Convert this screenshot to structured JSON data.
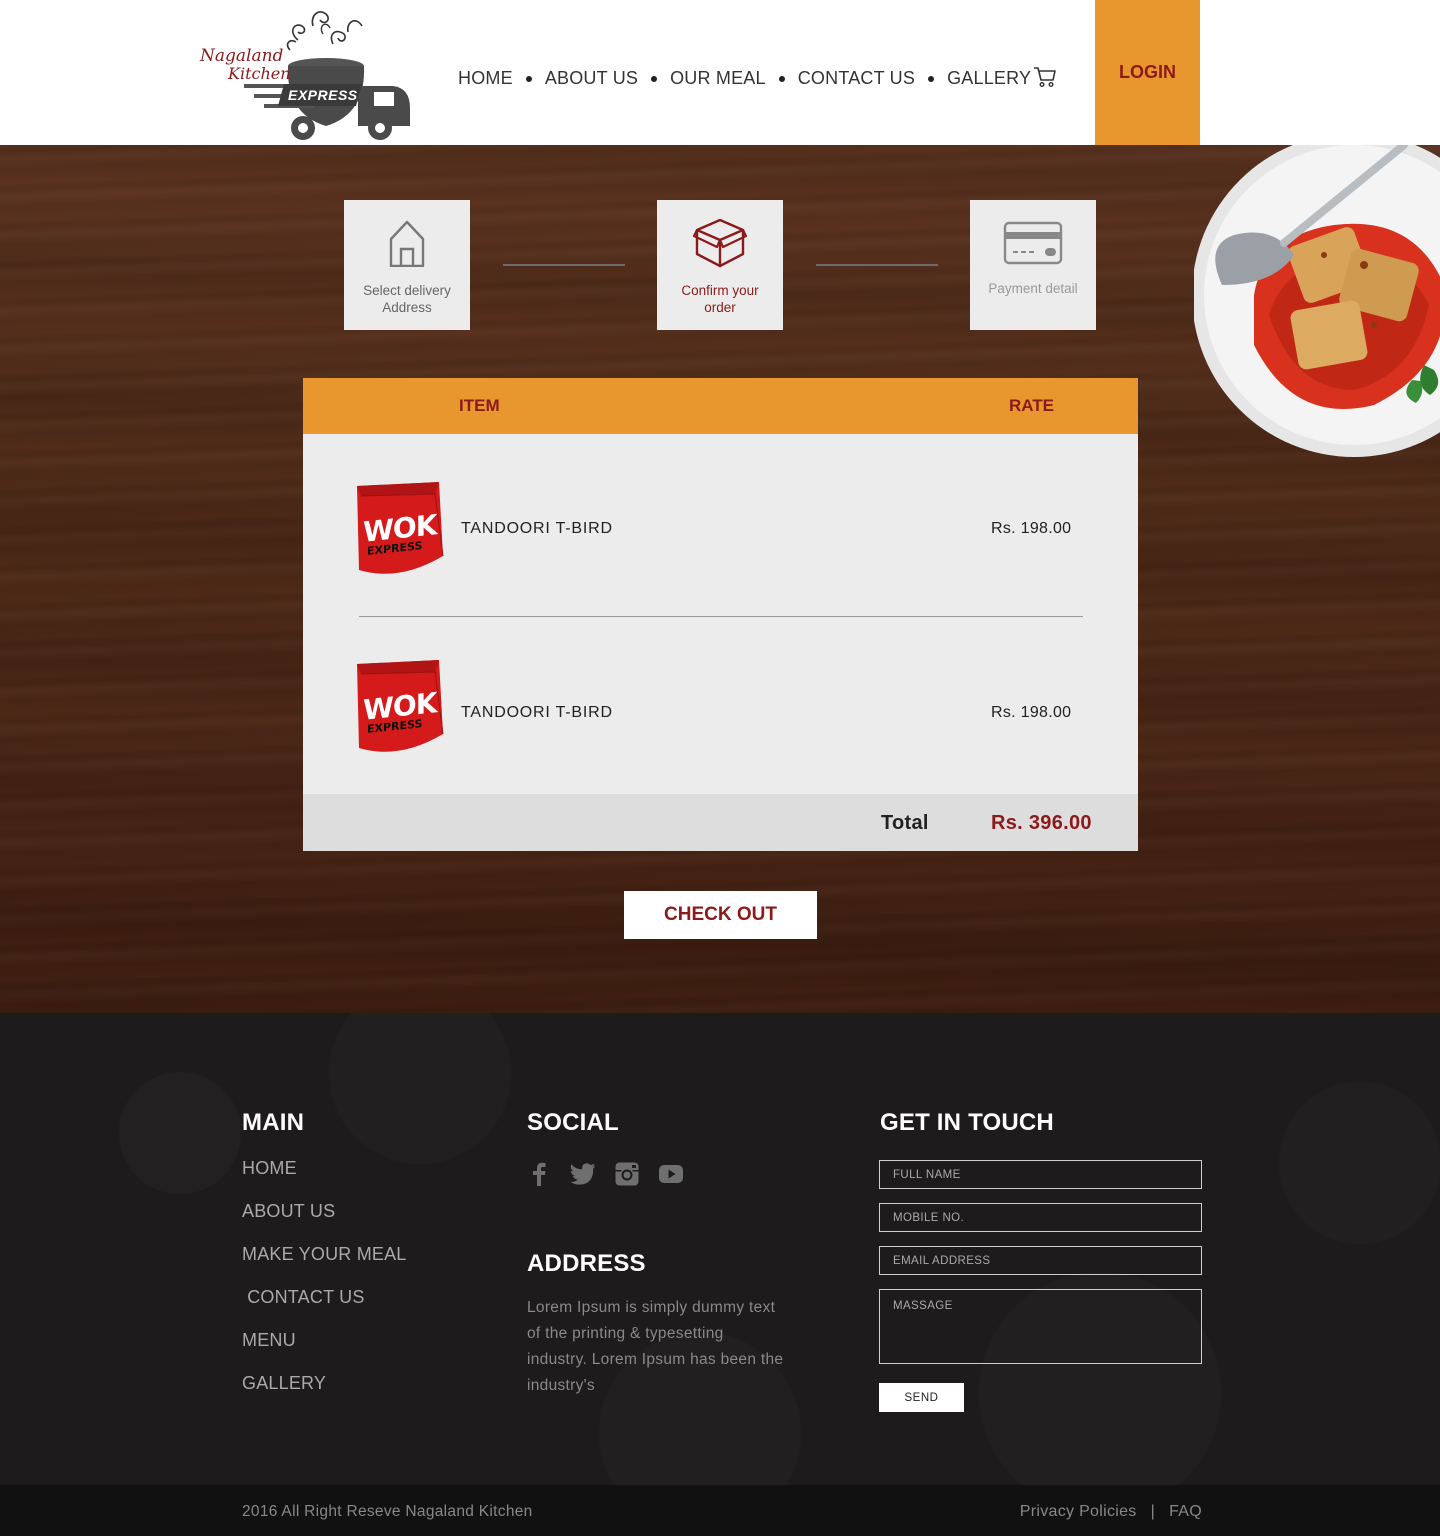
{
  "brand": {
    "line1": "Nagaland",
    "line2": "Kitchen",
    "badge": "EXPRESS"
  },
  "nav": {
    "items": [
      "HOME",
      "ABOUT US",
      "OUR MEAL",
      "CONTACT US",
      "GALLERY"
    ],
    "login": "LOGIN"
  },
  "steps": [
    {
      "label_line1": "Select delivery",
      "label_line2": "Address",
      "icon": "house-icon"
    },
    {
      "label_line1": "Confirm your",
      "label_line2": "order",
      "icon": "box-icon"
    },
    {
      "label_line1": "Payment detail",
      "label_line2": "",
      "icon": "credit-card-icon"
    }
  ],
  "order": {
    "headers": {
      "item": "ITEM",
      "rate": "RATE"
    },
    "rows": [
      {
        "name": "TANDOORI T-BIRD",
        "rate": "Rs. 198.00",
        "thumb_text1": "WOK",
        "thumb_text2": "EXPRESS"
      },
      {
        "name": "TANDOORI T-BIRD",
        "rate": "Rs. 198.00",
        "thumb_text1": "WOK",
        "thumb_text2": "EXPRESS"
      }
    ],
    "total_label": "Total",
    "total_value": "Rs. 396.00"
  },
  "checkout": "CHECK OUT",
  "footer": {
    "main_heading": "MAIN",
    "main_links": [
      "HOME",
      "ABOUT US",
      "MAKE YOUR MEAL",
      " CONTACT US",
      "MENU",
      "GALLERY"
    ],
    "social_heading": "SOCIAL",
    "social_icons": [
      "facebook-icon",
      "twitter-icon",
      "instagram-icon",
      "youtube-icon"
    ],
    "address_heading": "ADDRESS",
    "address_text": "Lorem Ipsum is simply dummy text of the printing & typesetting industry. Lorem Ipsum has been the industry's",
    "touch_heading": "GET IN TOUCH",
    "fields": {
      "full_name": "FULL NAME",
      "mobile": "MOBILE NO.",
      "email": "EMAIL ADDRESS",
      "message": "MASSAGE"
    },
    "send": "SEND",
    "copyright": "2016 All Right Reseve Nagaland Kitchen",
    "privacy": "Privacy Policies",
    "separator": "|",
    "faq": "FAQ"
  },
  "colors": {
    "accent": "#e8962e",
    "brand_red": "#8b1a1a",
    "footer_bg": "#1d1b1b"
  }
}
